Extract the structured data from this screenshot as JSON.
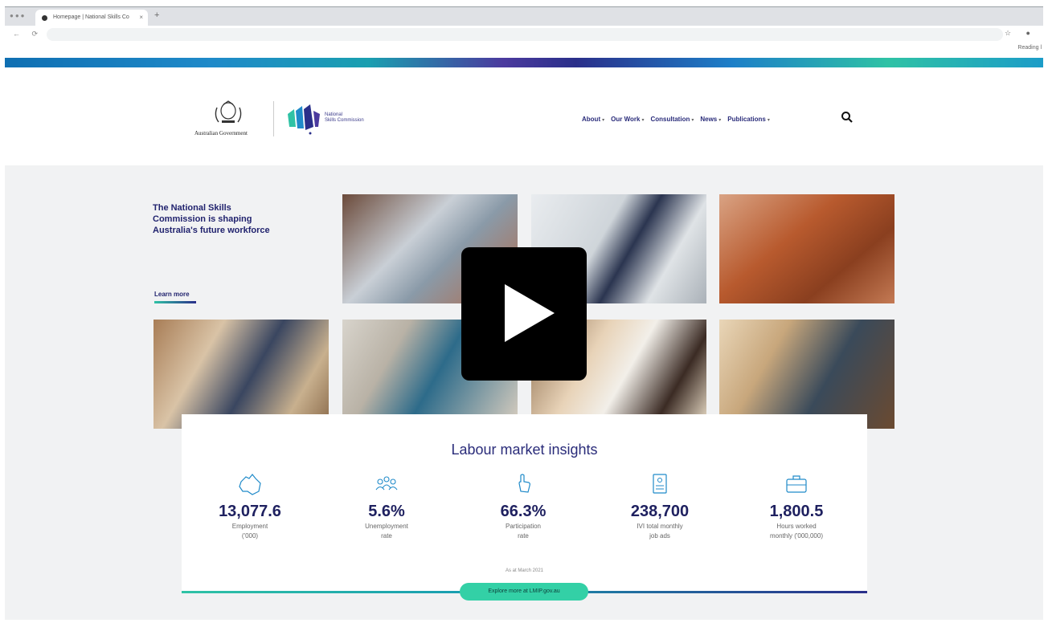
{
  "browser": {
    "tab_title": "Homepage | National Skills Co",
    "tab_close": "×",
    "new_tab": "+",
    "reading_list": "Reading l",
    "nav_glyphs": "← ⟳",
    "addr_glyphs": "☆ ●"
  },
  "header": {
    "gov_text": "Australian Government",
    "nsc_line1": "National",
    "nsc_line2": "Skills Commission",
    "nav": [
      "About",
      "Our Work",
      "Consultation",
      "News",
      "Publications"
    ],
    "caret": "▾"
  },
  "hero": {
    "title": "The National Skills Commission is shaping Australia's future workforce",
    "learn_more": "Learn more"
  },
  "insights": {
    "title": "Labour market insights",
    "stats": [
      {
        "value": "13,077.6",
        "label_line1": "Employment",
        "label_line2": "('000)",
        "icon": "australia-map-icon"
      },
      {
        "value": "5.6%",
        "label_line1": "Unemployment",
        "label_line2": "rate",
        "icon": "people-group-icon"
      },
      {
        "value": "66.3%",
        "label_line1": "Participation",
        "label_line2": "rate",
        "icon": "hand-pointer-icon"
      },
      {
        "value": "238,700",
        "label_line1": "IVI total monthly",
        "label_line2": "job ads",
        "icon": "document-icon"
      },
      {
        "value": "1,800.5",
        "label_line1": "Hours worked",
        "label_line2": "monthly ('000,000)",
        "icon": "briefcase-icon"
      }
    ],
    "as_at": "As at March 2021",
    "explore": "Explore more at LMIP.gov.au"
  },
  "colors": {
    "navy": "#2a2c7a",
    "teal": "#33d0a6"
  }
}
